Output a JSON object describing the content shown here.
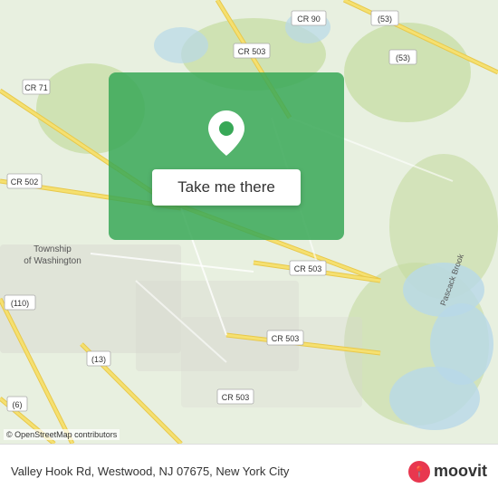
{
  "map": {
    "background_color": "#e8f0e0",
    "copyright": "© OpenStreetMap contributors"
  },
  "overlay": {
    "button_label": "Take me there",
    "pin_color": "#38a857"
  },
  "bottom_bar": {
    "address": "Valley Hook Rd, Westwood, NJ 07675, New York City",
    "logo_text": "moovit",
    "logo_icon": "📍"
  },
  "road_labels": [
    {
      "id": "cr90",
      "text": "CR 90"
    },
    {
      "id": "cr503a",
      "text": "CR 503"
    },
    {
      "id": "cr503b",
      "text": "CR 503"
    },
    {
      "id": "cr503c",
      "text": "CR 503"
    },
    {
      "id": "cr71",
      "text": "CR 71"
    },
    {
      "id": "cr502",
      "text": "CR 502"
    },
    {
      "id": "n53a",
      "text": "(53)"
    },
    {
      "id": "n53b",
      "text": "(53)"
    },
    {
      "id": "n110",
      "text": "(110)"
    },
    {
      "id": "n13",
      "text": "(13)"
    },
    {
      "id": "n6",
      "text": "(6)"
    }
  ],
  "area_labels": [
    {
      "id": "township",
      "text": "Township",
      "sub": "of Washington"
    },
    {
      "id": "pascack",
      "text": "Pascack Brook"
    }
  ]
}
